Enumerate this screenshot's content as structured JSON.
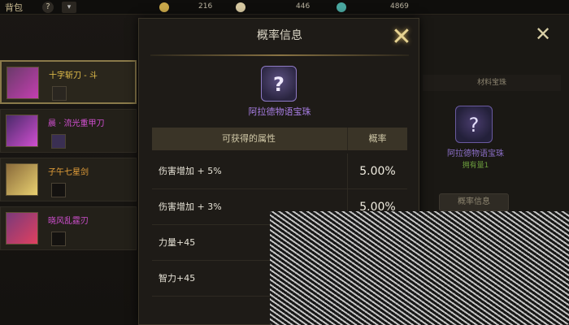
{
  "topbar": {
    "title": "背包",
    "help": "?",
    "dropdown": "▾",
    "currencies": [
      {
        "value": "216",
        "color": "#c9a84a"
      },
      {
        "value": "446",
        "color": "#d6c8a0"
      },
      {
        "value": "4869",
        "color": "#4aa8a0"
      }
    ]
  },
  "left_list": [
    {
      "name": "十字斩刀 - 斗",
      "color": "#e8c34c",
      "thumb": "#6a3a6a"
    },
    {
      "name": "晨 · 流光重甲刀",
      "color": "#d04fd0",
      "thumb": "#8a3a8a"
    },
    {
      "name": "子午七星剑",
      "color": "#e8a23a",
      "thumb": "#8a6a3a"
    },
    {
      "name": "晓风乱霆刃",
      "color": "#d04fd0",
      "thumb": "#7a3a7a"
    }
  ],
  "right_panel": {
    "header": "材料宝珠",
    "gem_name": "阿拉德物语宝珠",
    "owned": "拥有量1",
    "prob_button": "概率信息"
  },
  "modal": {
    "title": "概率信息",
    "item_name": "阿拉德物语宝珠",
    "columns": {
      "attr": "可获得的属性",
      "prob": "概率"
    },
    "rows": [
      {
        "attr": "伤害增加 + 5%",
        "prob": "5.00%"
      },
      {
        "attr": "伤害增加 + 3%",
        "prob": "5.00%"
      },
      {
        "attr": "力量+45",
        "prob": ""
      },
      {
        "attr": "智力+45",
        "prob": ""
      }
    ]
  }
}
